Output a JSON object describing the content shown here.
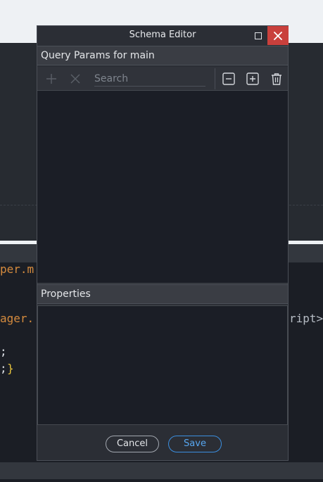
{
  "background": {
    "code_lines": [
      {
        "text": "per.m",
        "color": "orange"
      },
      {
        "text": "ager.",
        "color": "orange"
      },
      {
        "text": "ript>",
        "color": "grey"
      },
      {
        "text": ";",
        "color": "white"
      },
      {
        "text": ";",
        "color": "white"
      },
      {
        "text": "}",
        "color": "yellow"
      }
    ]
  },
  "dialog": {
    "title": "Schema Editor",
    "query_section": {
      "label": "Query Params for main",
      "search_placeholder": "Search",
      "items": []
    },
    "properties_section": {
      "label": "Properties"
    },
    "footer": {
      "cancel_label": "Cancel",
      "save_label": "Save"
    }
  },
  "icons": {
    "maximize": "maximize-icon",
    "close": "close-icon",
    "add": "plus-icon",
    "remove": "x-icon",
    "collapse_all": "minus-square-icon",
    "expand_all": "plus-square-icon",
    "delete": "trash-icon"
  },
  "colors": {
    "close_button": "#c9403c",
    "save_accent": "#3b8fe0",
    "panel_background": "#1b1e26",
    "dialog_background": "#2b2e35"
  }
}
